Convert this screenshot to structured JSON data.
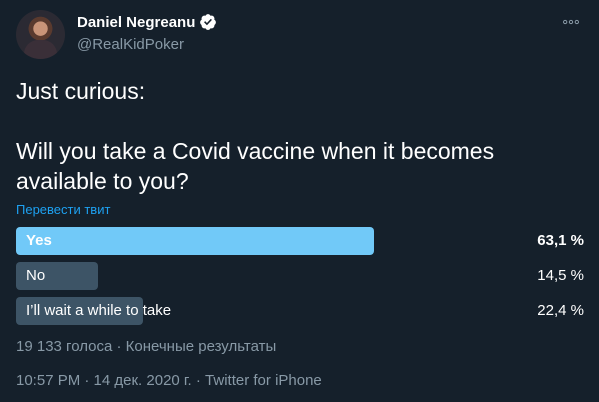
{
  "author": {
    "display_name": "Daniel Negreanu",
    "handle": "@RealKidPoker"
  },
  "tweet": {
    "text": "Just curious:\n\nWill you take a Covid vaccine when it becomes available to you?",
    "translate_link": "Перевести твит"
  },
  "poll": {
    "options": [
      {
        "label": "Yes",
        "percent_text": "63,1 %",
        "percent": 63.1,
        "winner": true
      },
      {
        "label": "No",
        "percent_text": "14,5 %",
        "percent": 14.5,
        "winner": false
      },
      {
        "label": "I’ll wait a while to take",
        "percent_text": "22,4 %",
        "percent": 22.4,
        "winner": false
      }
    ],
    "meta": "19 133 голоса · Конечные результаты"
  },
  "footer": {
    "timestamp": "10:57 PM · 14 дек. 2020 г. · Twitter for iPhone"
  },
  "colors": {
    "background": "#15202b",
    "winner_bar": "#71c9f8",
    "bar": "#3d5466",
    "link": "#1da1f2",
    "muted": "#8899a6"
  },
  "icons": [
    "verified-badge-icon",
    "more-options-icon"
  ]
}
